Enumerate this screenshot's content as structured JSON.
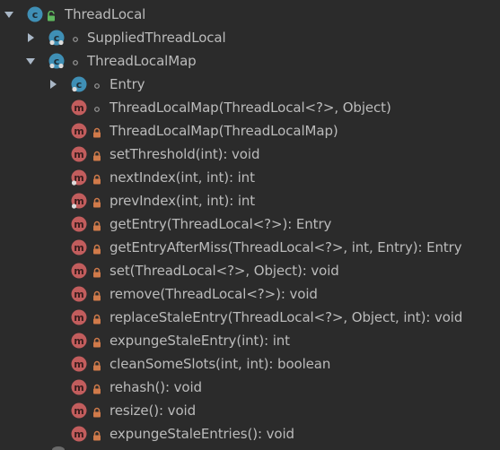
{
  "colors": {
    "background": "#2b2b2b",
    "text": "#bbbbbb",
    "class_icon": "#3f8fb5",
    "method_icon": "#c25d5d",
    "private_lock": "#d07a4a",
    "public_lock": "#5fb85f",
    "package_dot": "#9a9a9a"
  },
  "tree": {
    "root": {
      "label": "ThreadLocal",
      "icon": "class-icon",
      "visibility": "public-lock-icon",
      "expanded": true
    },
    "nodes": [
      {
        "label": "SuppliedThreadLocal",
        "icon": "class-icon",
        "visibility": "package-dot-icon",
        "expanded": false
      },
      {
        "label": "ThreadLocalMap",
        "icon": "class-icon",
        "visibility": "package-dot-icon",
        "expanded": true
      }
    ],
    "children": [
      {
        "label": "Entry",
        "icon": "class-icon",
        "visibility": "package-dot-icon",
        "expandable": true
      },
      {
        "label": "ThreadLocalMap(ThreadLocal<?>, Object)",
        "icon": "method-icon",
        "visibility": "package-dot-icon"
      },
      {
        "label": "ThreadLocalMap(ThreadLocalMap)",
        "icon": "method-icon",
        "visibility": "private-lock-icon"
      },
      {
        "label": "setThreshold(int): void",
        "icon": "method-icon",
        "visibility": "private-lock-icon"
      },
      {
        "label": "nextIndex(int, int): int",
        "icon": "static-method-icon",
        "visibility": "private-lock-icon"
      },
      {
        "label": "prevIndex(int, int): int",
        "icon": "static-method-icon",
        "visibility": "private-lock-icon"
      },
      {
        "label": "getEntry(ThreadLocal<?>): Entry",
        "icon": "method-icon",
        "visibility": "private-lock-icon"
      },
      {
        "label": "getEntryAfterMiss(ThreadLocal<?>, int, Entry): Entry",
        "icon": "method-icon",
        "visibility": "private-lock-icon"
      },
      {
        "label": "set(ThreadLocal<?>, Object): void",
        "icon": "method-icon",
        "visibility": "private-lock-icon"
      },
      {
        "label": "remove(ThreadLocal<?>): void",
        "icon": "method-icon",
        "visibility": "private-lock-icon"
      },
      {
        "label": "replaceStaleEntry(ThreadLocal<?>, Object, int): void",
        "icon": "method-icon",
        "visibility": "private-lock-icon"
      },
      {
        "label": "expungeStaleEntry(int): int",
        "icon": "method-icon",
        "visibility": "private-lock-icon"
      },
      {
        "label": "cleanSomeSlots(int, int): boolean",
        "icon": "method-icon",
        "visibility": "private-lock-icon"
      },
      {
        "label": "rehash(): void",
        "icon": "method-icon",
        "visibility": "private-lock-icon"
      },
      {
        "label": "resize(): void",
        "icon": "method-icon",
        "visibility": "private-lock-icon"
      },
      {
        "label": "expungeStaleEntries(): void",
        "icon": "method-icon",
        "visibility": "private-lock-icon"
      }
    ]
  }
}
